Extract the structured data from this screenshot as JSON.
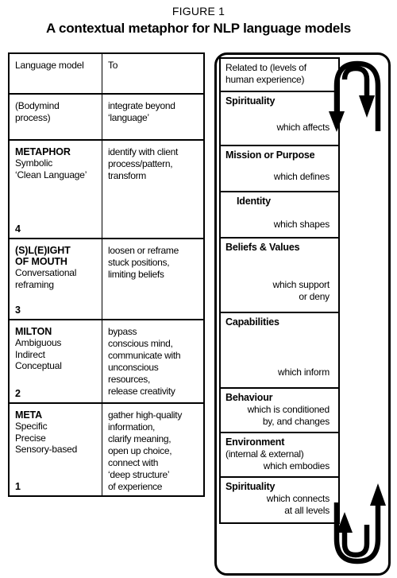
{
  "figure": {
    "label": "FIGURE 1",
    "title": "A contextual metaphor for NLP language models"
  },
  "left_table": {
    "headers": {
      "col1": "Language model",
      "col2": "To"
    },
    "rows": [
      {
        "model_title": "",
        "model_plain": "(Bodymind\n process)",
        "model_sub": "",
        "number": "",
        "to": "integrate beyond\n‘language’"
      },
      {
        "model_title": "METAPHOR",
        "model_sub": "Symbolic\n‘Clean Language’",
        "number": "4",
        "to": "identify with client\nprocess/pattern,\ntransform"
      },
      {
        "model_title": "(S)L(E)IGHT\nOF MOUTH",
        "model_sub": "Conversational\nreframing",
        "number": "3",
        "to": "loosen or reframe\nstuck positions,\nlimiting beliefs"
      },
      {
        "model_title": "MILTON",
        "model_sub": "Ambiguous\nIndirect\nConceptual",
        "number": "2",
        "to": "bypass\nconscious mind,\ncommunicate with\nunconscious\nresources,\nrelease creativity"
      },
      {
        "model_title": "META",
        "model_sub": "Specific\nPrecise\nSensory-based",
        "number": "1",
        "to": "gather high-quality\ninformation,\nclarify meaning,\nopen up choice,\nconnect with\n‘deep structure’\nof experience"
      }
    ]
  },
  "right_column": {
    "header": "Related to (levels of\nhuman experience)",
    "levels": [
      {
        "name": "Spirituality",
        "relation": "which affects",
        "note": ""
      },
      {
        "name": "Mission or Purpose",
        "relation": "which defines",
        "note": ""
      },
      {
        "name": "Identity",
        "relation": "which shapes",
        "note": ""
      },
      {
        "name": "Beliefs & Values",
        "relation": "which support\nor deny",
        "note": ""
      },
      {
        "name": "Capabilities",
        "relation": "which inform",
        "note": ""
      },
      {
        "name": "Behaviour",
        "relation": "which is conditioned\nby, and changes",
        "note": ""
      },
      {
        "name": "Environment",
        "relation": "which embodies",
        "note": "(internal & external)"
      },
      {
        "name": "Spirituality",
        "relation": "which connects\nat all levels",
        "note": ""
      }
    ]
  },
  "arrows": {
    "top_outer": "downward-loop-arrow-outer",
    "top_inner": "downward-loop-arrow-inner",
    "bottom_outer": "upward-loop-arrow-outer",
    "bottom_inner": "upward-loop-arrow-inner"
  },
  "colors": {
    "ink": "#000000",
    "paper": "#ffffff"
  }
}
